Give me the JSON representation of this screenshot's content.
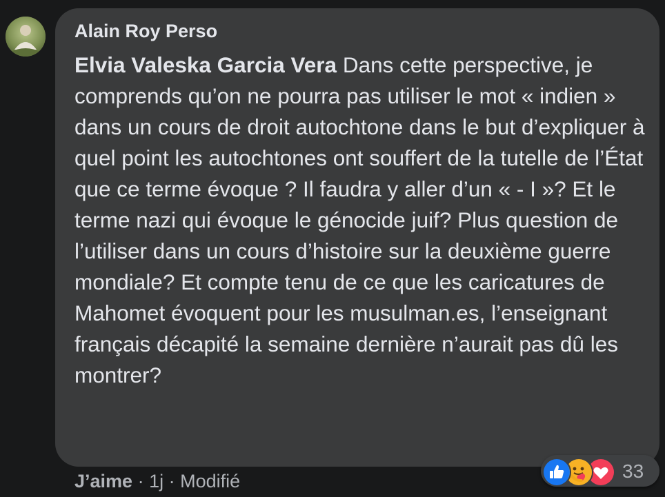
{
  "comment": {
    "author": "Alain Roy Perso",
    "mention": "Elvia Valeska Garcia Vera",
    "text": " Dans cette perspective, je comprends qu’on ne pourra pas utiliser le mot « indien » dans un cours de droit autochtone dans le but d’expliquer à quel point les autochtones ont souffert de la tutelle de l’État que ce terme évoque ? Il faudra y aller d’un « - I »? Et le terme nazi qui évoque le génocide juif? Plus question de l’utiliser dans un cours d’histoire sur la deuxième guerre mondiale? Et compte tenu de ce que les caricatures de Mahomet évoquent pour les musulman.es, l’enseignant français décapité la semaine dernière n’aurait pas dû les montrer?"
  },
  "actions": {
    "like_label": "J’aime",
    "separator": " · ",
    "time": "1j",
    "edited_label": "Modifié"
  },
  "reactions": {
    "icons": [
      "like-icon",
      "care-icon",
      "love-icon"
    ],
    "count": "33"
  },
  "colors": {
    "background": "#18191a",
    "bubble": "#3a3b3c",
    "text": "#e4e6eb",
    "secondary_text": "#b0b3b8",
    "like_blue": "#1877f2",
    "love_red": "#f33e58",
    "care_yellow": "#f7b125"
  }
}
